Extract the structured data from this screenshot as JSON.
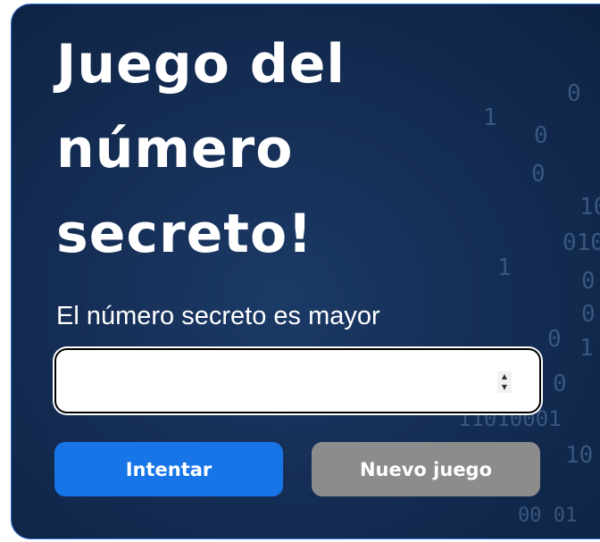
{
  "game": {
    "title": "Juego del número secreto!",
    "hint": "El número secreto es mayor",
    "input": {
      "value": "",
      "placeholder": ""
    },
    "buttons": {
      "try_label": "Intentar",
      "new_game_label": "Nuevo juego"
    }
  },
  "background_digits": [
    "0",
    "1",
    "0",
    "0",
    "10",
    "010",
    "1",
    "0",
    "0",
    "0",
    "1",
    "0",
    "11010001",
    "10",
    "00 01"
  ],
  "colors": {
    "panel_background": "#162f57",
    "panel_border": "#2a6fd6",
    "primary_button": "#1875e8",
    "secondary_button": "#8c8c8c",
    "text": "#ffffff"
  }
}
